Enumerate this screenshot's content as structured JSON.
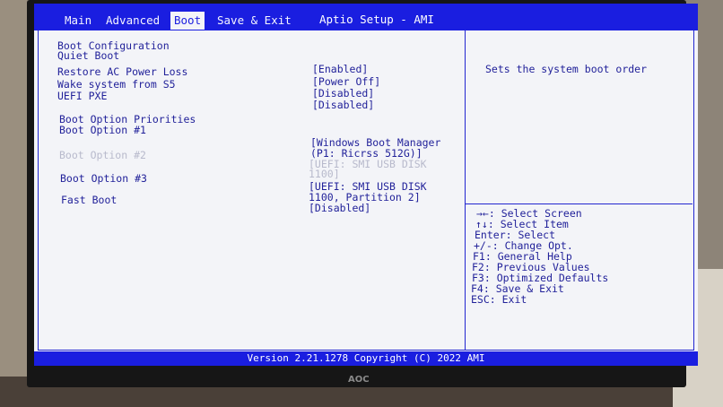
{
  "tabs": [
    "Main",
    "Advanced",
    "Boot",
    "Save & Exit"
  ],
  "title": "Aptio Setup - AMI",
  "section_header": "Boot Configuration",
  "settings": [
    {
      "label": "Quiet Boot",
      "value": "[Enabled]"
    },
    {
      "label": "Restore AC Power Loss",
      "value": "[Power Off]"
    },
    {
      "label": "Wake system from S5",
      "value": "[Disabled]"
    },
    {
      "label": "UEFI PXE",
      "value": "[Disabled]"
    }
  ],
  "boot_priorities_header": "Boot Option Priorities",
  "boot_options": [
    {
      "label": "Boot Option #1",
      "value_lines": [
        "[Windows Boot Manager",
        "(P1: Ricrss 512G)]"
      ]
    },
    {
      "label": "Boot Option #2",
      "value_lines": [
        "[UEFI: SMI USB DISK",
        "1100]"
      ]
    },
    {
      "label": "Boot Option #3",
      "value_lines": [
        "[UEFI: SMI USB DISK",
        "1100, Partition 2]"
      ]
    }
  ],
  "fast_boot": {
    "label": "Fast Boot",
    "value": "[Disabled]"
  },
  "help_text": "Sets the system boot order",
  "keys": [
    "→←: Select Screen",
    "↑↓: Select Item",
    "Enter: Select",
    "+/-: Change Opt.",
    "F1: General Help",
    "F2: Previous Values",
    "F3: Optimized Defaults",
    "F4: Save & Exit",
    "ESC: Exit"
  ],
  "version": "Version 2.21.1278 Copyright (C) 2022 AMI",
  "monitor_logo": "AOC"
}
